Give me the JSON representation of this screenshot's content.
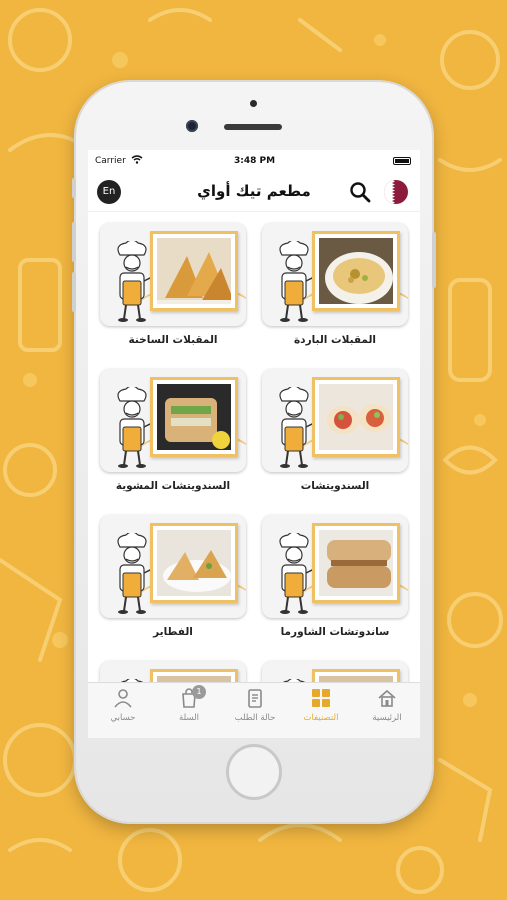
{
  "status_bar": {
    "carrier": "Carrier",
    "time": "3:48 PM"
  },
  "header": {
    "title": "مطعم تيك أواي",
    "lang_label": "En"
  },
  "categories": [
    {
      "label": "المقبلات الباردة",
      "photo": "hummus"
    },
    {
      "label": "المقبلات الساخنة",
      "photo": "samosa"
    },
    {
      "label": "السندويتشات",
      "photo": "wrap"
    },
    {
      "label": "السندويتشات المشوية",
      "photo": "grilled-sandwich"
    },
    {
      "label": "ساندوتشات الشاورما",
      "photo": "shawarma"
    },
    {
      "label": "الفطاير",
      "photo": "fatayer"
    }
  ],
  "tabbar": {
    "items": [
      {
        "label": "الرئيسية",
        "icon": "home-icon"
      },
      {
        "label": "التصنيفات",
        "icon": "categories-icon",
        "active": true
      },
      {
        "label": "حالة الطلب",
        "icon": "order-status-icon"
      },
      {
        "label": "السلة",
        "icon": "cart-icon",
        "badge": "1"
      },
      {
        "label": "حسابي",
        "icon": "account-icon"
      }
    ]
  },
  "colors": {
    "background": "#f1b640",
    "accent": "#e5a92e",
    "flag": "#8d1b3d"
  }
}
